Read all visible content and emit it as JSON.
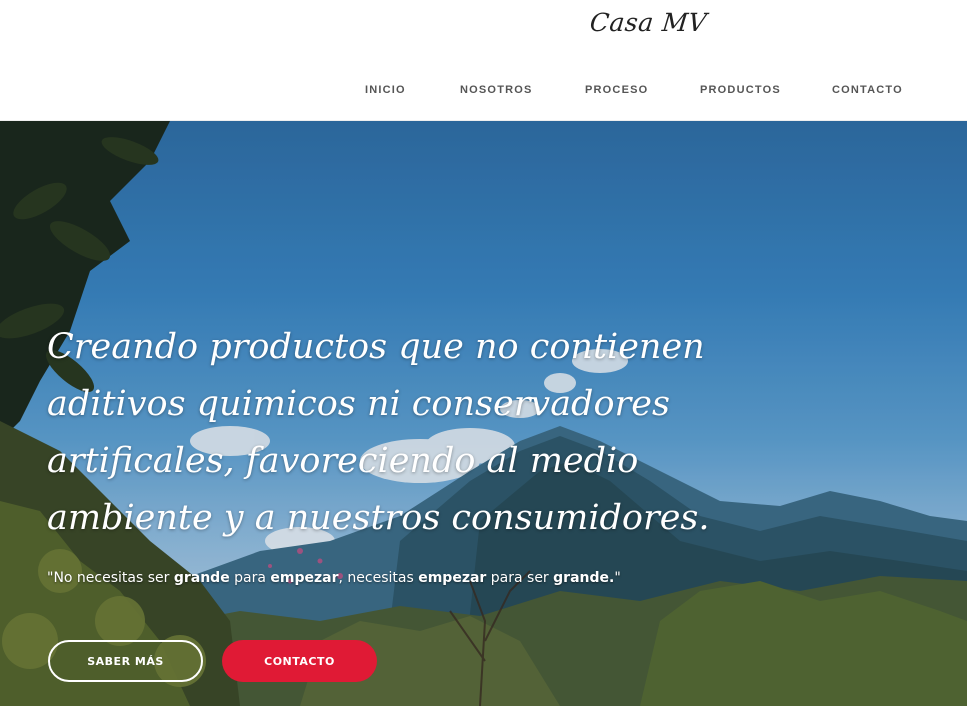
{
  "header": {
    "logo": "Casa MV",
    "nav": [
      "INICIO",
      "NOSOTROS",
      "PROCESO",
      "PRODUCTOS",
      "CONTACTO"
    ]
  },
  "hero": {
    "headline": "Creando productos que no contienen aditivos quimicos ni conservadores artificales, favoreciendo al medio ambiente y a nuestros consumidores.",
    "quote": {
      "p1": "\"No necesitas ser ",
      "b1": "grande",
      "p2": " para ",
      "b2": "empezar",
      "p3": ", necesitas ",
      "b3": "empezar",
      "p4": " para ser ",
      "b4": "grande.",
      "p5": "\""
    },
    "buttons": {
      "primary": "SABER MÁS",
      "secondary": "CONTACTO"
    }
  },
  "colors": {
    "accent": "#e01a35",
    "sky": "#3a86c4",
    "nav_text": "#555555"
  }
}
